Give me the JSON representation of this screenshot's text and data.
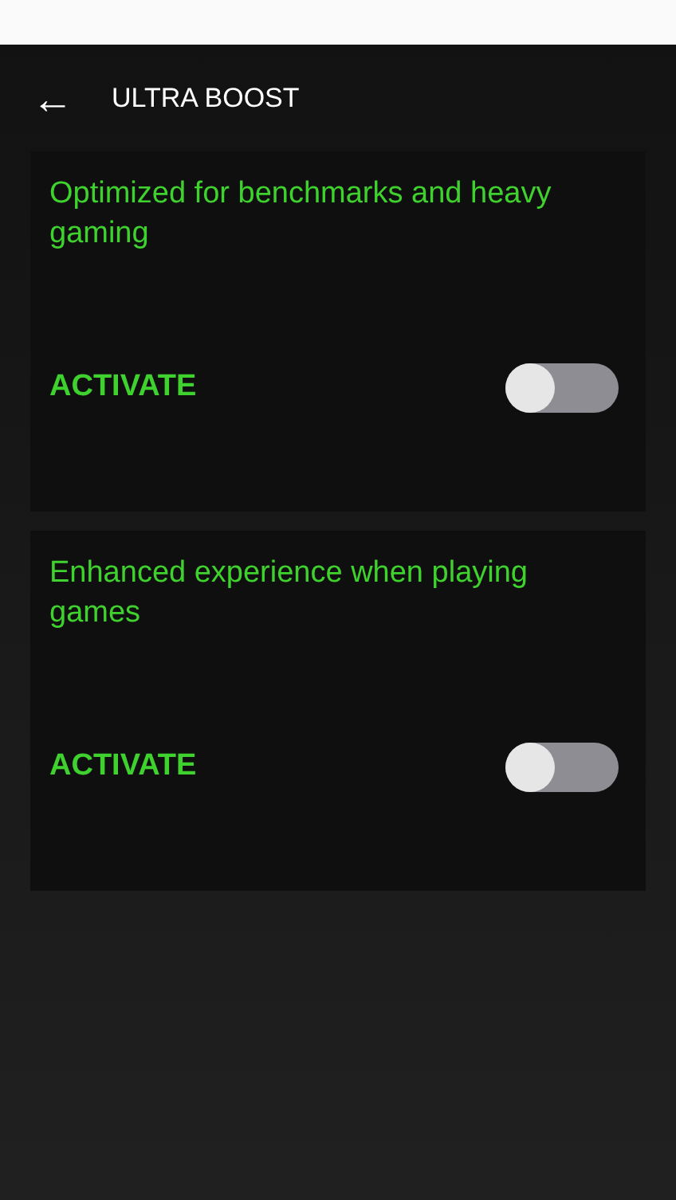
{
  "header": {
    "back_icon": "←",
    "title": "ULTRA BOOST"
  },
  "modes": [
    {
      "description": "Optimized for benchmarks and heavy gaming",
      "label": "ACTIVATE",
      "on": false
    },
    {
      "description": "Enhanced experience when playing games",
      "label": "ACTIVATE",
      "on": false
    }
  ]
}
